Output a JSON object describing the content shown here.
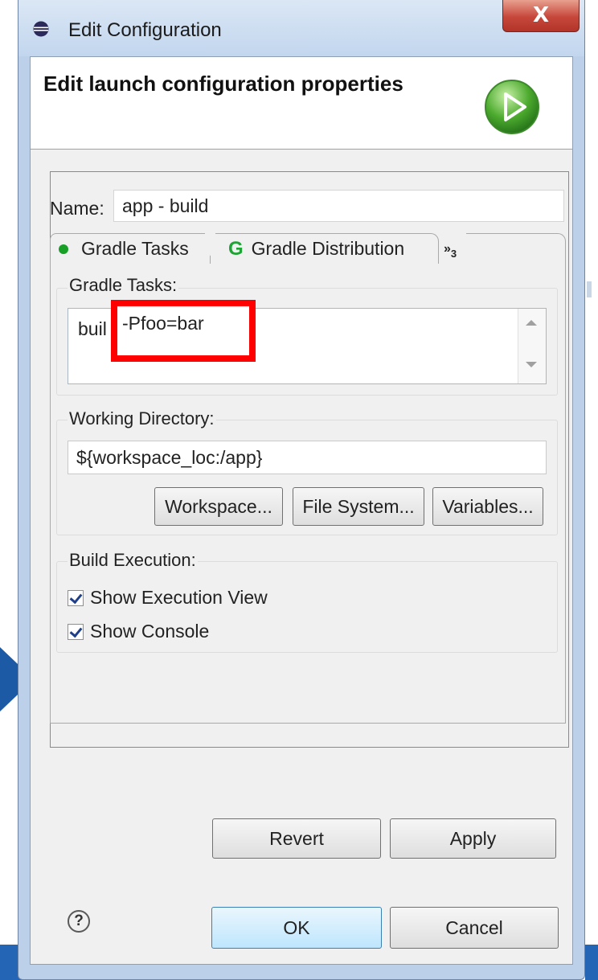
{
  "window": {
    "title": "Edit Configuration",
    "close_label": "X"
  },
  "header": {
    "title": "Edit launch configuration properties",
    "icon": "run-icon"
  },
  "name_field": {
    "label": "Name:",
    "value": "app - build"
  },
  "tabs": [
    {
      "label": "Gradle Tasks",
      "icon": "green-dot-icon",
      "active": true
    },
    {
      "label": "Gradle Distribution",
      "icon": "gradle-g-icon",
      "active": false
    }
  ],
  "tabs_overflow": {
    "label": "»",
    "count": "3"
  },
  "gradle_tasks": {
    "group_label": "Gradle Tasks:",
    "value": "buil",
    "highlighted_value": "-Pfoo=bar"
  },
  "working_directory": {
    "group_label": "Working Directory:",
    "value": "${workspace_loc:/app}",
    "buttons": {
      "workspace": "Workspace...",
      "file_system": "File System...",
      "variables": "Variables..."
    }
  },
  "build_execution": {
    "group_label": "Build Execution:",
    "show_execution_view": {
      "label": "Show Execution View",
      "checked": true
    },
    "show_console": {
      "label": "Show Console",
      "checked": true
    }
  },
  "panel_buttons": {
    "revert": "Revert",
    "apply": "Apply"
  },
  "footer": {
    "help": "?",
    "ok": "OK",
    "cancel": "Cancel"
  },
  "colors": {
    "highlight": "#ff0000",
    "accent_blue": "#2565b6",
    "gradle_green": "#1da435"
  }
}
